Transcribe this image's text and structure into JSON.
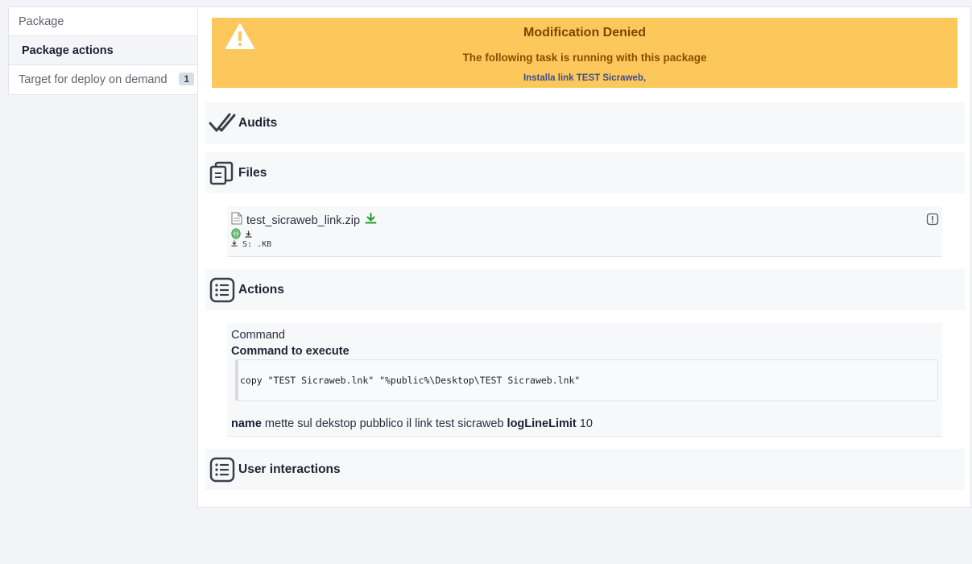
{
  "sidebar": {
    "items": [
      {
        "label": "Package"
      },
      {
        "label": "Package actions"
      },
      {
        "label": "Target for deploy on demand",
        "badge": "1"
      }
    ]
  },
  "alert": {
    "title": "Modification Denied",
    "message": "The following task is running with this package",
    "task": "Installa link TEST Sicraweb,"
  },
  "sections": {
    "audits": "Audits",
    "files": "Files",
    "actions": "Actions",
    "user_interactions": "User interactions"
  },
  "file": {
    "name": "test_sicraweb_link.zip",
    "size_text": "S: .KB"
  },
  "action": {
    "type": "Command",
    "command_title": "Command to execute",
    "command": "copy \"TEST Sicraweb.lnk\" \"%public%\\Desktop\\TEST Sicraweb.lnk\"",
    "name_label": "name",
    "name_value": "mette sul dekstop pubblico il link test sicraweb",
    "loglimit_label": "logLineLimit",
    "loglimit_value": "10"
  },
  "colors": {
    "alert_bg": "#fcc85c",
    "download_green": "#1f9d2e"
  }
}
